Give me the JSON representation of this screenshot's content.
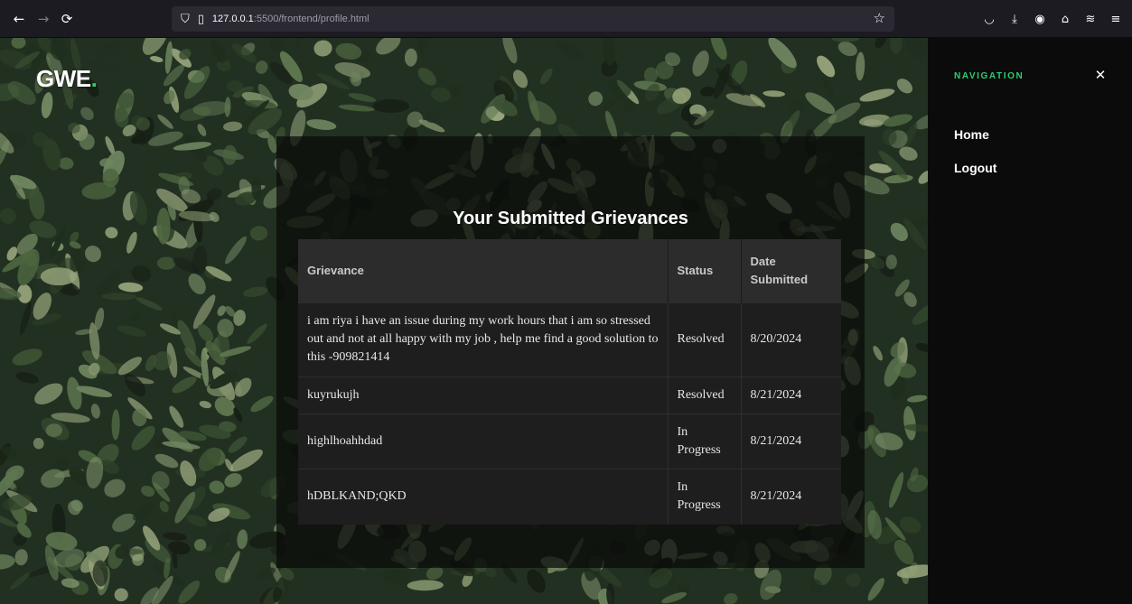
{
  "browser": {
    "url_host": "127.0.0.1",
    "url_rest": ":5500/frontend/profile.html"
  },
  "logo": {
    "text": "GWE",
    "dot": "."
  },
  "panel": {
    "title": "Your Submitted Grievances",
    "columns": [
      "Grievance",
      "Status",
      "Date Submitted"
    ],
    "rows": [
      {
        "grievance": "i am riya i have an issue during my work hours that i am so stressed out and not at all happy with my job , help me find a good solution to this -909821414",
        "status": "Resolved",
        "date": "8/20/2024"
      },
      {
        "grievance": "kuyrukujh",
        "status": "Resolved",
        "date": "8/21/2024"
      },
      {
        "grievance": "highlhoahhdad",
        "status": "In Progress",
        "date": "8/21/2024"
      },
      {
        "grievance": "hDBLKAND;QKD",
        "status": "In Progress",
        "date": "8/21/2024"
      }
    ]
  },
  "sidebar": {
    "heading": "NAVIGATION",
    "close_icon": "close-icon",
    "links": [
      {
        "label": "Home"
      },
      {
        "label": "Logout"
      }
    ]
  },
  "colors": {
    "accent": "#2ecc71",
    "sidebar_bg": "#0b0b0b",
    "table_bg": "#1e1e1e"
  }
}
